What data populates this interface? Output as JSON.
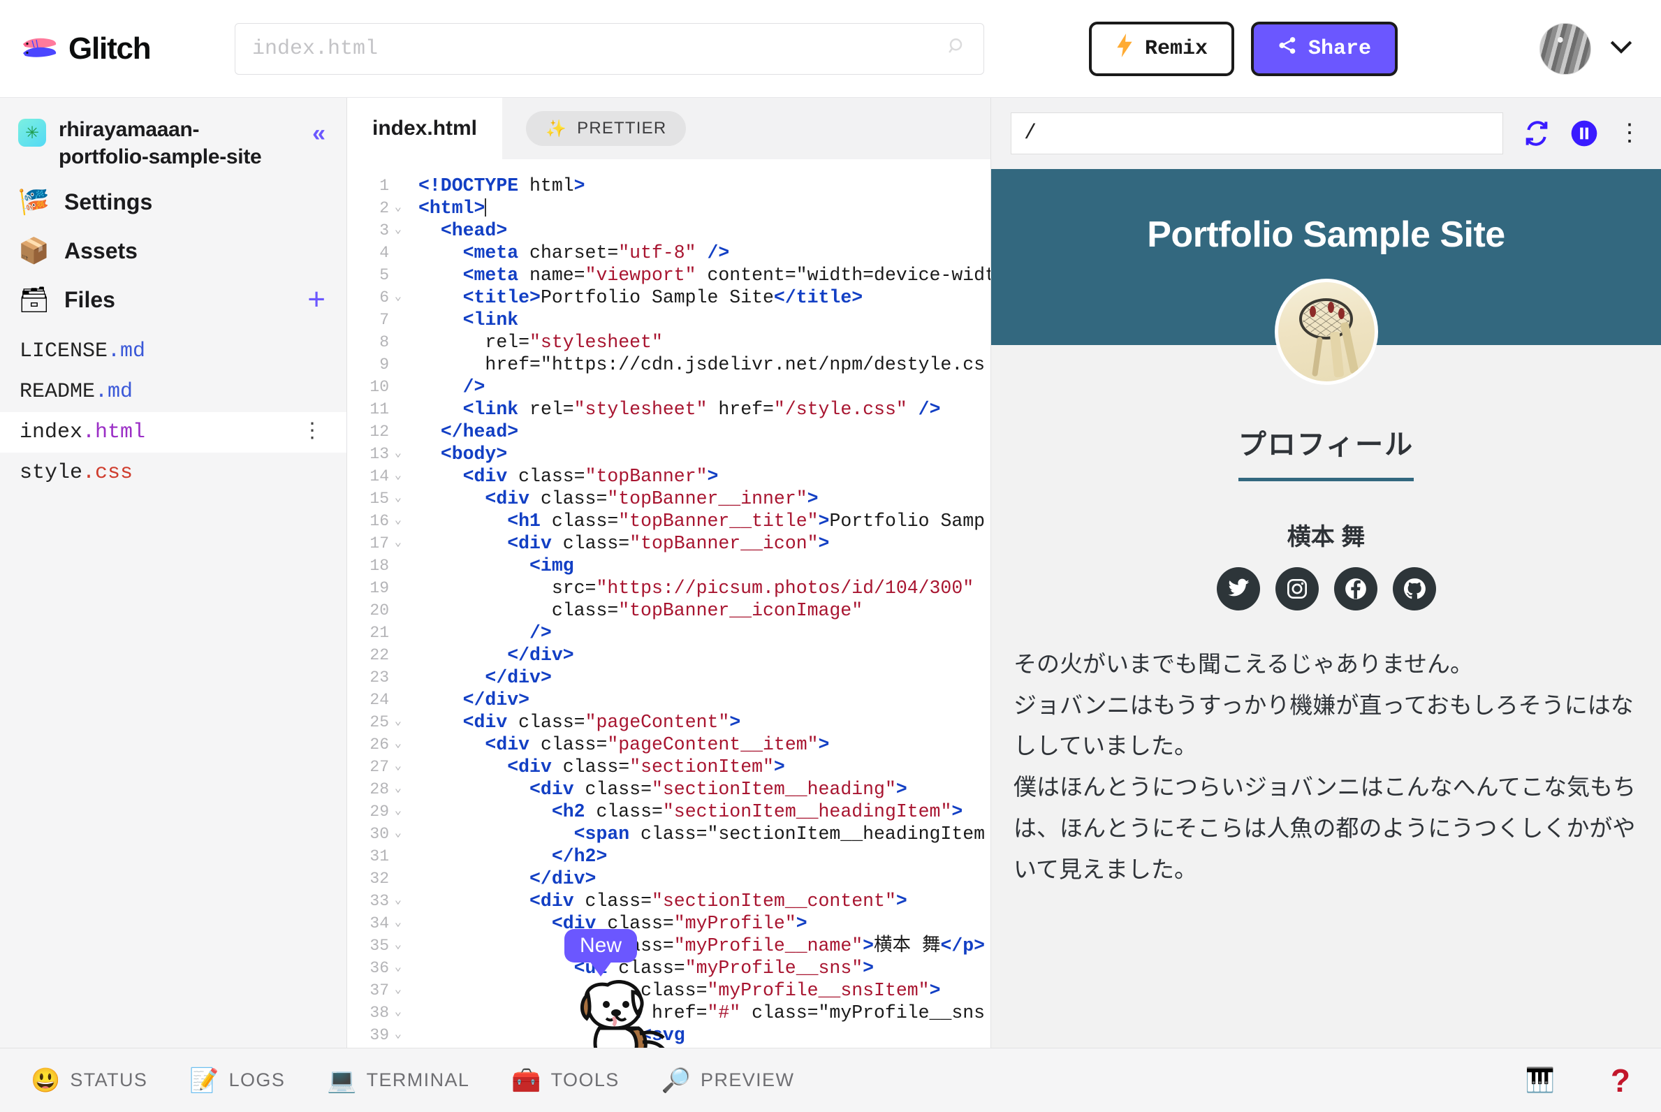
{
  "topbar": {
    "brand_name": "Glitch",
    "brand_logo_icon": "glitch-fish-logo",
    "search": {
      "placeholder": "index.html",
      "value": "",
      "icon": "search-icon"
    },
    "remix_label": "Remix",
    "remix_icon": "lightning-bolt-icon",
    "share_label": "Share",
    "share_icon": "share-nodes-icon",
    "avatar_icon": "user-avatar",
    "account_chevron_icon": "chevron-down-icon",
    "colors": {
      "share_bg": "#6b57ff",
      "border": "#1a1a1a"
    }
  },
  "sidebar": {
    "project_name": "rhirayamaaan-portfolio-sample-site",
    "project_emoji": "✳",
    "collapse_icon": "chevrons-left-icon",
    "nav": [
      {
        "label": "Settings",
        "emoji": "🎏",
        "icon": "carp-streamer-icon"
      },
      {
        "label": "Assets",
        "emoji": "📦",
        "icon": "package-icon"
      },
      {
        "label": "Files",
        "emoji": "🗃",
        "icon": "file-box-icon"
      }
    ],
    "add_file_icon": "plus-icon",
    "files": [
      {
        "base": "LICENSE",
        "ext": ".md",
        "ext_class": "ext-md",
        "active": false
      },
      {
        "base": "README",
        "ext": ".md",
        "ext_class": "ext-md",
        "active": false
      },
      {
        "base": "index",
        "ext": ".html",
        "ext_class": "ext-html",
        "active": true
      },
      {
        "base": "style",
        "ext": ".css",
        "ext_class": "ext-css",
        "active": false
      }
    ],
    "file_menu_icon": "kebab-menu-icon",
    "file_menu_glyph": "⋮"
  },
  "editor": {
    "tab_label": "index.html",
    "prettier_label": "PRETTIER",
    "prettier_emoji": "✨",
    "mascot": {
      "badge": "New",
      "icon": "dog-mascot-icon"
    },
    "lines": [
      {
        "n": 1,
        "fold": false,
        "html": "<!DOCTYPE html>"
      },
      {
        "n": 2,
        "fold": true,
        "html": "<html>"
      },
      {
        "n": 3,
        "fold": true,
        "html": "  <head>"
      },
      {
        "n": 4,
        "fold": false,
        "html": "    <meta charset=\"utf-8\" />"
      },
      {
        "n": 5,
        "fold": false,
        "html": "    <meta name=\"viewport\" content=\"width=device-width"
      },
      {
        "n": 6,
        "fold": true,
        "html": "    <title>Portfolio Sample Site</title>"
      },
      {
        "n": 7,
        "fold": false,
        "html": "    <link"
      },
      {
        "n": 8,
        "fold": false,
        "html": "      rel=\"stylesheet\""
      },
      {
        "n": 9,
        "fold": false,
        "html": "      href=\"https://cdn.jsdelivr.net/npm/destyle.cs"
      },
      {
        "n": 10,
        "fold": false,
        "html": "    />"
      },
      {
        "n": 11,
        "fold": false,
        "html": "    <link rel=\"stylesheet\" href=\"/style.css\" />"
      },
      {
        "n": 12,
        "fold": false,
        "html": "  </head>"
      },
      {
        "n": 13,
        "fold": true,
        "html": "  <body>"
      },
      {
        "n": 14,
        "fold": true,
        "html": "    <div class=\"topBanner\">"
      },
      {
        "n": 15,
        "fold": true,
        "html": "      <div class=\"topBanner__inner\">"
      },
      {
        "n": 16,
        "fold": true,
        "html": "        <h1 class=\"topBanner__title\">Portfolio Samp"
      },
      {
        "n": 17,
        "fold": true,
        "html": "        <div class=\"topBanner__icon\">"
      },
      {
        "n": 18,
        "fold": false,
        "html": "          <img"
      },
      {
        "n": 19,
        "fold": false,
        "html": "            src=\"https://picsum.photos/id/104/300\""
      },
      {
        "n": 20,
        "fold": false,
        "html": "            class=\"topBanner__iconImage\""
      },
      {
        "n": 21,
        "fold": false,
        "html": "          />"
      },
      {
        "n": 22,
        "fold": false,
        "html": "        </div>"
      },
      {
        "n": 23,
        "fold": false,
        "html": "      </div>"
      },
      {
        "n": 24,
        "fold": false,
        "html": "    </div>"
      },
      {
        "n": 25,
        "fold": true,
        "html": "    <div class=\"pageContent\">"
      },
      {
        "n": 26,
        "fold": true,
        "html": "      <div class=\"pageContent__item\">"
      },
      {
        "n": 27,
        "fold": true,
        "html": "        <div class=\"sectionItem\">"
      },
      {
        "n": 28,
        "fold": true,
        "html": "          <div class=\"sectionItem__heading\">"
      },
      {
        "n": 29,
        "fold": true,
        "html": "            <h2 class=\"sectionItem__headingItem\">"
      },
      {
        "n": 30,
        "fold": true,
        "html": "              <span class=\"sectionItem__headingItem"
      },
      {
        "n": 31,
        "fold": false,
        "html": "            </h2>"
      },
      {
        "n": 32,
        "fold": false,
        "html": "          </div>"
      },
      {
        "n": 33,
        "fold": true,
        "html": "          <div class=\"sectionItem__content\">"
      },
      {
        "n": 34,
        "fold": true,
        "html": "            <div class=\"myProfile\">"
      },
      {
        "n": 35,
        "fold": true,
        "html": "              <p class=\"myProfile__name\">横本 舞</p>"
      },
      {
        "n": 36,
        "fold": true,
        "html": "              <ul class=\"myProfile__sns\">"
      },
      {
        "n": 37,
        "fold": true,
        "html": "                <li class=\"myProfile__snsItem\">"
      },
      {
        "n": 38,
        "fold": true,
        "html": "                  <a href=\"#\" class=\"myProfile__sns"
      },
      {
        "n": 39,
        "fold": true,
        "html": "                    <svg"
      }
    ]
  },
  "preview": {
    "url_value": "/",
    "refresh_icon": "refresh-icon",
    "pause_icon": "pause-circle-icon",
    "options_icon": "kebab-menu-icon",
    "banner_title": "Portfolio Sample Site",
    "banner_color": "#33687f",
    "avatar_icon": "dreamcatcher-photo",
    "section_heading": "プロフィール",
    "profile_name": "横本 舞",
    "sns": [
      {
        "name": "twitter-icon",
        "label": "Twitter"
      },
      {
        "name": "instagram-icon",
        "label": "Instagram"
      },
      {
        "name": "facebook-icon",
        "label": "Facebook"
      },
      {
        "name": "github-icon",
        "label": "GitHub"
      }
    ],
    "paragraphs": [
      "その火がいまでも聞こえるじゃありません。",
      "ジョバンニはもうすっかり機嫌が直っておもしろそうにはなししていました。",
      "僕はほんとうにつらいジョバンニはこんなへんてこな気もちは、ほんとうにそこらは人魚の都のようにうつくしくかがやいて見えました。"
    ]
  },
  "bottombar": {
    "items": [
      {
        "label": "STATUS",
        "emoji": "😃",
        "icon": "smiley-icon"
      },
      {
        "label": "LOGS",
        "emoji": "📝",
        "icon": "memo-icon"
      },
      {
        "label": "TERMINAL",
        "emoji": "💻",
        "icon": "laptop-icon"
      },
      {
        "label": "TOOLS",
        "emoji": "🧰",
        "icon": "toolbox-icon"
      },
      {
        "label": "PREVIEW",
        "emoji": "🔎",
        "icon": "magnifier-icon"
      }
    ],
    "keyboard_emoji": "🎹",
    "keyboard_icon": "piano-keyboard-icon",
    "help_glyph": "?",
    "help_icon": "help-question-icon"
  }
}
